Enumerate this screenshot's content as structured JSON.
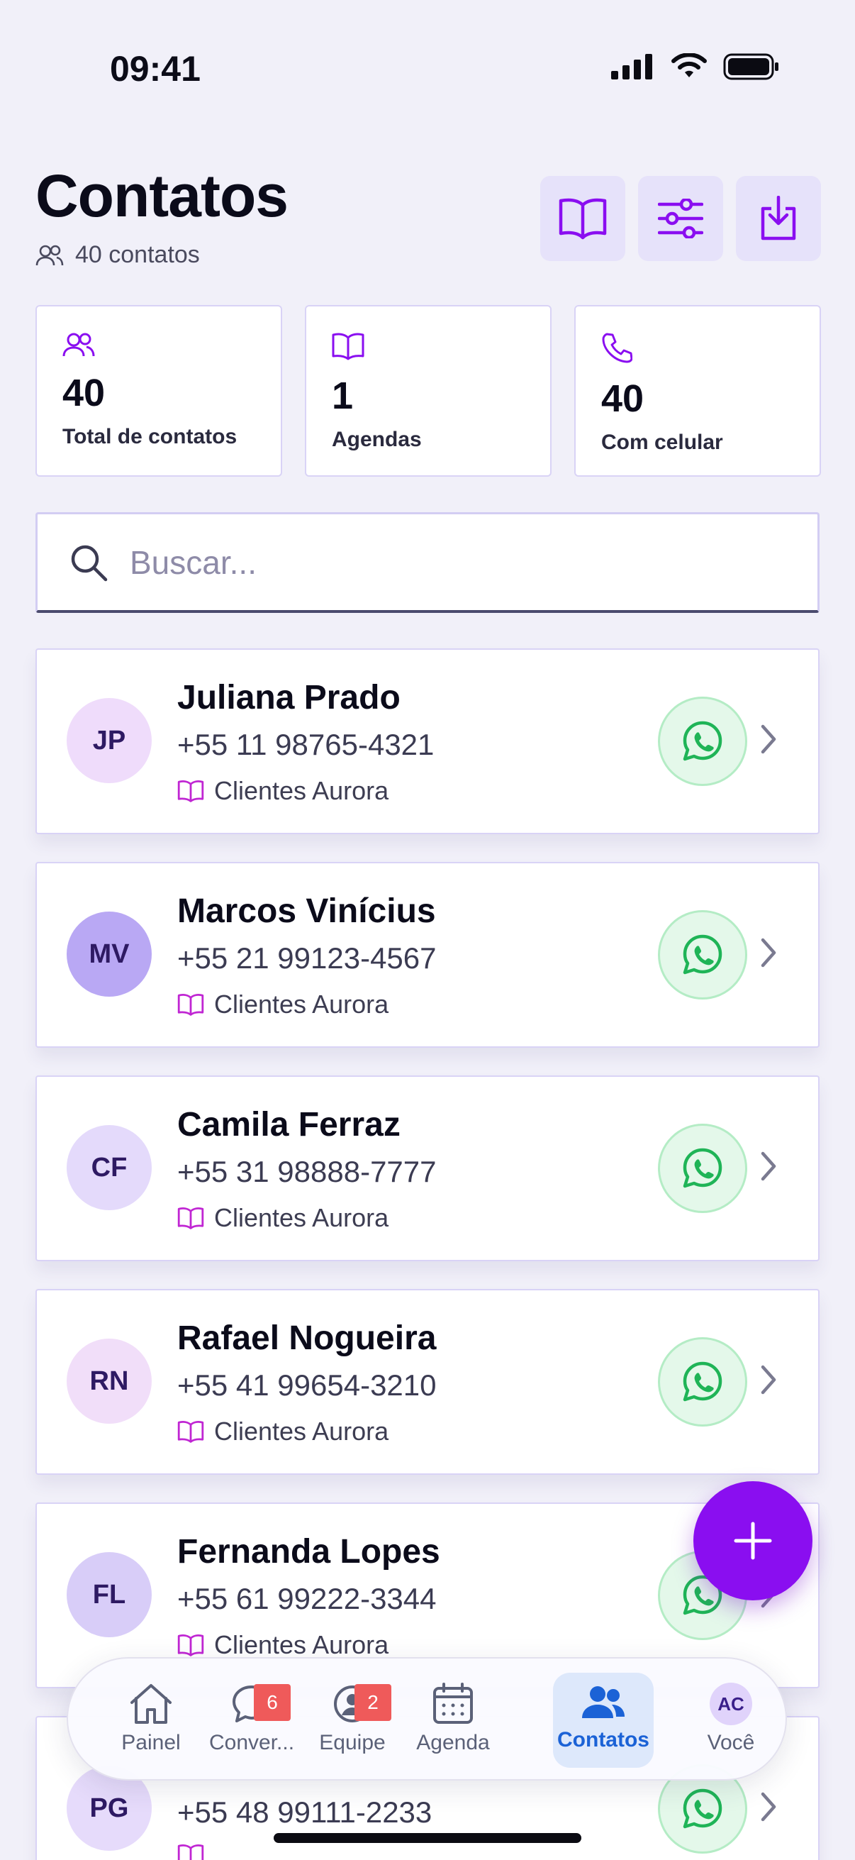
{
  "status_bar": {
    "time": "09:41"
  },
  "header": {
    "title": "Contatos",
    "count_label": "40 contatos",
    "actions": [
      {
        "name": "agendas",
        "icon": "book-open-icon"
      },
      {
        "name": "filters",
        "icon": "sliders-icon"
      },
      {
        "name": "import",
        "icon": "download-icon"
      }
    ]
  },
  "stats": [
    {
      "icon": "users-icon",
      "value": "40",
      "label": "Total de contatos"
    },
    {
      "icon": "book-open-icon",
      "value": "1",
      "label": "Agendas"
    },
    {
      "icon": "phone-icon",
      "value": "40",
      "label": "Com celular"
    }
  ],
  "search": {
    "placeholder": "Buscar..."
  },
  "contacts": [
    {
      "initials": "JP",
      "name": "Juliana Prado",
      "phone": "+55 11 98765-4321",
      "agenda": "Clientes Aurora",
      "avatar_color": "#efdcfb"
    },
    {
      "initials": "MV",
      "name": "Marcos Vinícius",
      "phone": "+55 21 99123-4567",
      "agenda": "Clientes Aurora",
      "avatar_color": "#b9a8f4"
    },
    {
      "initials": "CF",
      "name": "Camila Ferraz",
      "phone": "+55 31 98888-7777",
      "agenda": "Clientes Aurora",
      "avatar_color": "#e4dafb"
    },
    {
      "initials": "RN",
      "name": "Rafael Nogueira",
      "phone": "+55 41 99654-3210",
      "agenda": "Clientes Aurora",
      "avatar_color": "#f1def9"
    },
    {
      "initials": "FL",
      "name": "Fernanda Lopes",
      "phone": "+55 61 99222-3344",
      "agenda": "Clientes Aurora",
      "avatar_color": "#d8cdf8"
    },
    {
      "initials": "PG",
      "name": "",
      "phone": "+55 48 99111-2233",
      "agenda": "",
      "avatar_color": "#e6dbfb"
    }
  ],
  "fab": {
    "icon": "plus-icon"
  },
  "tabs": [
    {
      "label": "Painel",
      "icon": "home-icon",
      "badge": ""
    },
    {
      "label": "Conver...",
      "icon": "chat-icon",
      "badge": "6"
    },
    {
      "label": "Equipe",
      "icon": "team-icon",
      "badge": "2"
    },
    {
      "label": "Agenda",
      "icon": "calendar-icon",
      "badge": ""
    },
    {
      "label": "Contatos",
      "icon": "contacts-icon",
      "badge": "",
      "active": true
    },
    {
      "label": "Você",
      "icon": "avatar-ac",
      "badge": "",
      "initials": "AC"
    }
  ],
  "colors": {
    "accent": "#8a0ef0",
    "whatsapp": "#22c55e",
    "active_tab": "#1b62d6",
    "badge": "#ef5a5a"
  }
}
